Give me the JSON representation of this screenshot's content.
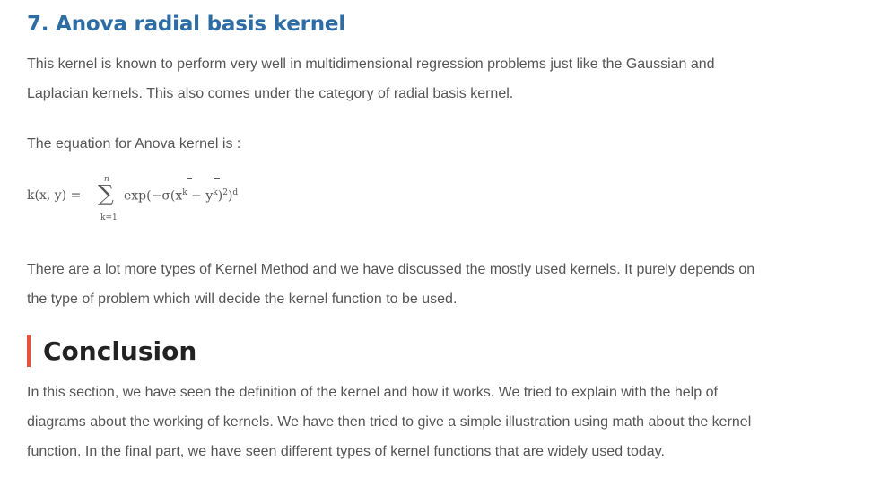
{
  "section": {
    "heading": "7. Anova radial basis kernel",
    "paragraph1_line1": "This kernel is known to perform very well in multidimensional regression problems just like the Gaussian and",
    "paragraph1_line2": "Laplacian kernels. This also comes under the category of radial basis kernel.",
    "equation_intro": "The equation for Anova kernel is :",
    "equation": {
      "lhs": "k(x, y) =",
      "sum_upper": "n",
      "sum_lower": "k=1",
      "rhs_prefix": "exp(−σ(x",
      "sup_k1": "k",
      "rhs_mid": " − y",
      "sup_k2": "k",
      "rhs_suffix": ")",
      "sup_2": "2",
      "rhs_end": ")",
      "sup_d": "d"
    },
    "paragraph3_line1": "There are a lot more types of Kernel Method and we have discussed the mostly used kernels. It purely depends on",
    "paragraph3_line2": "the type of problem which will decide the kernel function to be used."
  },
  "conclusion": {
    "heading": "Conclusion",
    "line1": "In this section, we have seen the definition of the kernel and how it works. We tried to explain with the help of",
    "line2": "diagrams about the working of kernels. We have then tried to give a simple illustration using math about the kernel",
    "line3": "function. In the final part, we have seen different types of kernel functions that are widely used today."
  },
  "colors": {
    "heading_blue": "#2e6ca4",
    "accent_red": "#e2543f",
    "body_text": "#555555"
  }
}
